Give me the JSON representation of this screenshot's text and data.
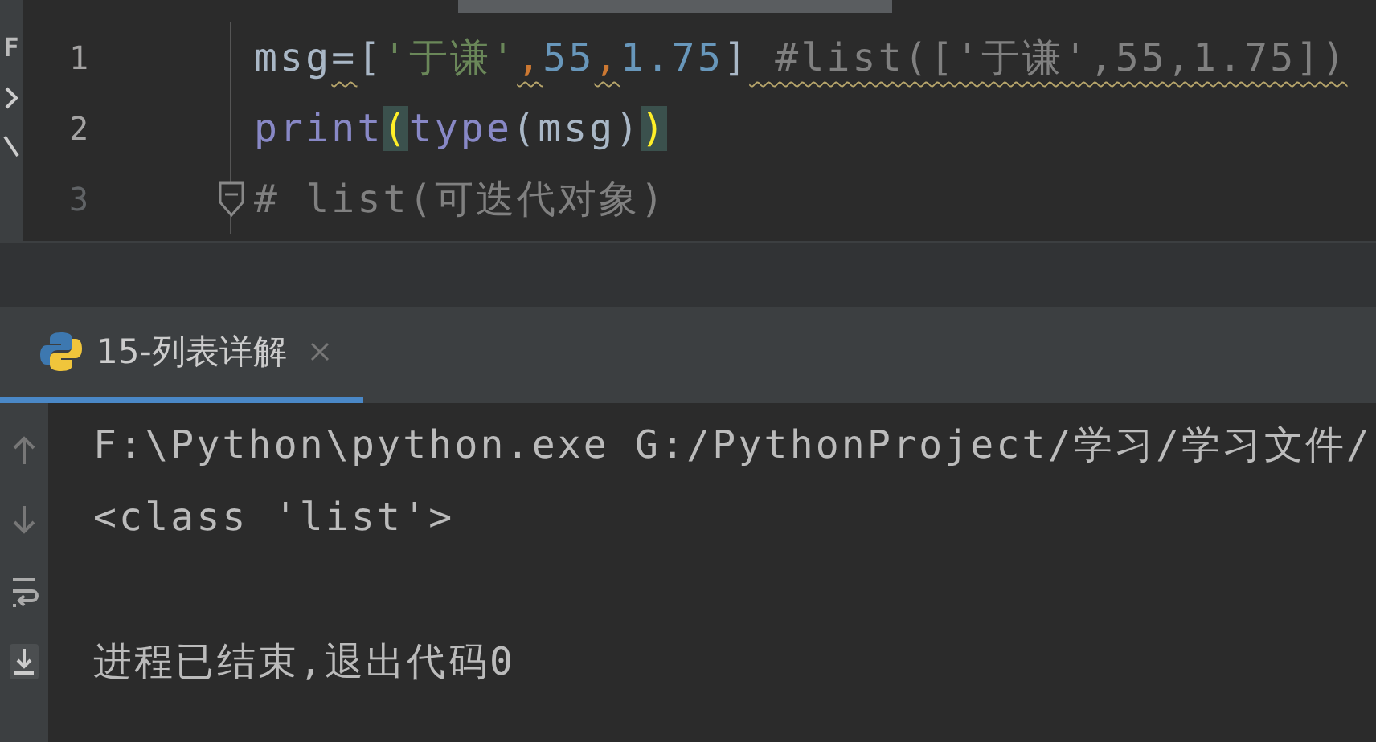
{
  "sidebar": {
    "label": "F"
  },
  "editor": {
    "lines": [
      {
        "number": "1",
        "fold": false,
        "tokens": [
          {
            "kind": "plain",
            "text": "msg"
          },
          {
            "kind": "plain",
            "text": "=",
            "warning": true
          },
          {
            "kind": "plain",
            "text": "["
          },
          {
            "kind": "string",
            "text": "'于谦'"
          },
          {
            "kind": "comma",
            "text": ",",
            "warning": true
          },
          {
            "kind": "number",
            "text": "55"
          },
          {
            "kind": "comma",
            "text": ",",
            "warning": true
          },
          {
            "kind": "number",
            "text": "1.75"
          },
          {
            "kind": "plain",
            "text": "]"
          },
          {
            "kind": "comment",
            "text": " #list(['于谦',55,1.75])",
            "warning": true
          }
        ]
      },
      {
        "number": "2",
        "fold": false,
        "tokens": [
          {
            "kind": "builtin",
            "text": "print"
          },
          {
            "kind": "brace",
            "text": "("
          },
          {
            "kind": "builtin",
            "text": "type"
          },
          {
            "kind": "plain",
            "text": "(msg)"
          },
          {
            "kind": "brace",
            "text": ")"
          }
        ]
      },
      {
        "number": "3",
        "fold": true,
        "tokens": [
          {
            "kind": "comment",
            "text": "# list(可迭代对象)"
          }
        ]
      }
    ]
  },
  "run_panel": {
    "tabs": [
      {
        "label": "15-列表详解",
        "selected": true
      }
    ],
    "output_blocks": [
      {
        "lines": [
          "F:\\Python\\python.exe G:/PythonProject/学习/学习文件/",
          "<class 'list'>"
        ]
      },
      {
        "lines": [
          "进程已结束,退出代码0"
        ]
      }
    ]
  }
}
